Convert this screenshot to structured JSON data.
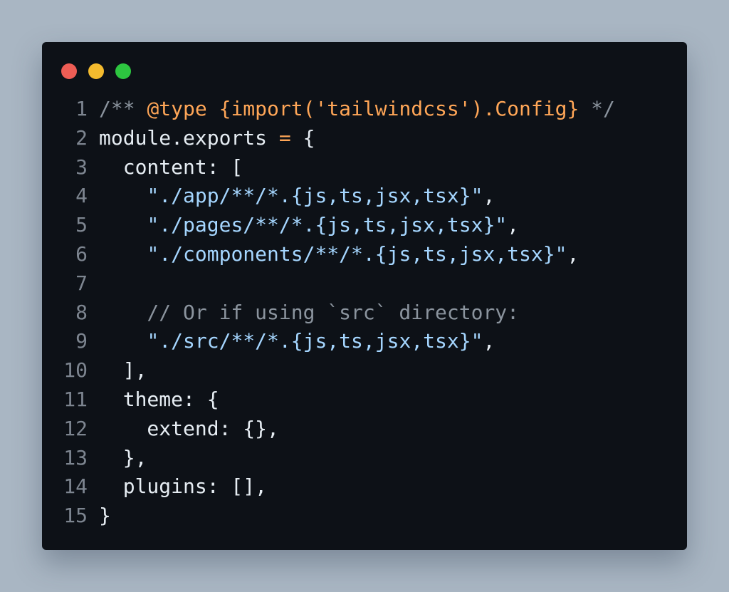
{
  "window": {
    "traffic_lights": [
      {
        "name": "close",
        "color": "#ee5d55"
      },
      {
        "name": "minimize",
        "color": "#f4bb2e"
      },
      {
        "name": "zoom",
        "color": "#2dc640"
      }
    ]
  },
  "colors": {
    "plain": "#e6edf3",
    "comment": "#8b949e",
    "keyword": "#ffa657",
    "string": "#a5d6ff",
    "operator": "#ff7b72",
    "line_number": "#7d8590",
    "background": "#0d1117"
  },
  "code": {
    "lines": [
      {
        "n": "1",
        "tokens": [
          {
            "t": "/** ",
            "c": "comment"
          },
          {
            "t": "@type {import('tailwindcss').Config}",
            "c": "keyword"
          },
          {
            "t": " */",
            "c": "comment"
          }
        ]
      },
      {
        "n": "2",
        "tokens": [
          {
            "t": "module.exports ",
            "c": "plain"
          },
          {
            "t": "=",
            "c": "keyword"
          },
          {
            "t": " {",
            "c": "plain"
          }
        ]
      },
      {
        "n": "3",
        "tokens": [
          {
            "t": "  content: [",
            "c": "plain"
          }
        ]
      },
      {
        "n": "4",
        "tokens": [
          {
            "t": "    ",
            "c": "plain"
          },
          {
            "t": "\"./app/**/*.{js,ts,jsx,tsx}\"",
            "c": "string"
          },
          {
            "t": ",",
            "c": "plain"
          }
        ]
      },
      {
        "n": "5",
        "tokens": [
          {
            "t": "    ",
            "c": "plain"
          },
          {
            "t": "\"./pages/**/*.{js,ts,jsx,tsx}\"",
            "c": "string"
          },
          {
            "t": ",",
            "c": "plain"
          }
        ]
      },
      {
        "n": "6",
        "tokens": [
          {
            "t": "    ",
            "c": "plain"
          },
          {
            "t": "\"./components/**/*.{js,ts,jsx,tsx}\"",
            "c": "string"
          },
          {
            "t": ",",
            "c": "plain"
          }
        ]
      },
      {
        "n": "7",
        "tokens": []
      },
      {
        "n": "8",
        "tokens": [
          {
            "t": "    // Or if using `src` directory:",
            "c": "comment"
          }
        ]
      },
      {
        "n": "9",
        "tokens": [
          {
            "t": "    ",
            "c": "plain"
          },
          {
            "t": "\"./src/**/*.{js,ts,jsx,tsx}\"",
            "c": "string"
          },
          {
            "t": ",",
            "c": "plain"
          }
        ]
      },
      {
        "n": "10",
        "tokens": [
          {
            "t": "  ],",
            "c": "plain"
          }
        ]
      },
      {
        "n": "11",
        "tokens": [
          {
            "t": "  theme: {",
            "c": "plain"
          }
        ]
      },
      {
        "n": "12",
        "tokens": [
          {
            "t": "    extend: {},",
            "c": "plain"
          }
        ]
      },
      {
        "n": "13",
        "tokens": [
          {
            "t": "  },",
            "c": "plain"
          }
        ]
      },
      {
        "n": "14",
        "tokens": [
          {
            "t": "  plugins: [],",
            "c": "plain"
          }
        ]
      },
      {
        "n": "15",
        "tokens": [
          {
            "t": "}",
            "c": "plain"
          }
        ]
      }
    ]
  }
}
